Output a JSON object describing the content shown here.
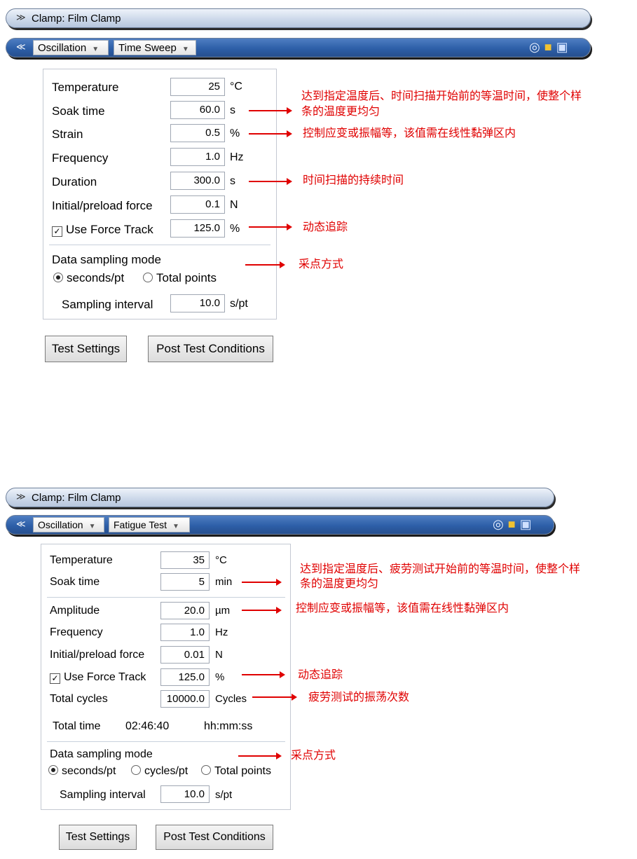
{
  "panel1": {
    "clamp_label": "Clamp: Film Clamp",
    "mode_select": "Oscillation",
    "test_select": "Time Sweep",
    "rows": [
      {
        "label": "Temperature",
        "value": "25",
        "unit": "°C"
      },
      {
        "label": "Soak time",
        "value": "60.0",
        "unit": "s"
      },
      {
        "label": "Strain",
        "value": "0.5",
        "unit": "%"
      },
      {
        "label": "Frequency",
        "value": "1.0",
        "unit": "Hz"
      },
      {
        "label": "Duration",
        "value": "300.0",
        "unit": "s"
      },
      {
        "label": "Initial/preload force",
        "value": "0.1",
        "unit": "N"
      },
      {
        "label": "Use Force Track",
        "value": "125.0",
        "unit": "%"
      }
    ],
    "sampling": {
      "title": "Data sampling mode",
      "opt1": "seconds/pt",
      "opt2": "Total points",
      "interval_label": "Sampling interval",
      "interval_value": "10.0",
      "interval_unit": "s/pt"
    },
    "buttons": {
      "test_settings": "Test Settings",
      "post_test": "Post Test Conditions"
    },
    "notes": {
      "soak_line1": "达到指定温度后、时间扫描开始前的等温时间，使整个样",
      "soak_line2": "条的温度更均匀",
      "strain": "控制应变或振幅等，该值需在线性黏弹区内",
      "duration": "时间扫描的持续时间",
      "force_track": "动态追踪",
      "sampling": "采点方式"
    }
  },
  "panel2": {
    "clamp_label": "Clamp: Film Clamp",
    "mode_select": "Oscillation",
    "test_select": "Fatigue Test",
    "rows": [
      {
        "label": "Temperature",
        "value": "35",
        "unit": "°C"
      },
      {
        "label": "Soak time",
        "value": "5",
        "unit": "min"
      },
      {
        "label": "Amplitude",
        "value": "20.0",
        "unit": "µm"
      },
      {
        "label": "Frequency",
        "value": "1.0",
        "unit": "Hz"
      },
      {
        "label": "Initial/preload force",
        "value": "0.01",
        "unit": "N"
      },
      {
        "label": "Use Force Track",
        "value": "125.0",
        "unit": "%"
      },
      {
        "label": "Total cycles",
        "value": "10000.0",
        "unit": "Cycles"
      }
    ],
    "total_time": {
      "label": "Total time",
      "value": "02:46:40",
      "unit": "hh:mm:ss"
    },
    "sampling": {
      "title": "Data sampling mode",
      "opt1": "seconds/pt",
      "opt2": "cycles/pt",
      "opt3": "Total points",
      "interval_label": "Sampling interval",
      "interval_value": "10.0",
      "interval_unit": "s/pt"
    },
    "buttons": {
      "test_settings": "Test Settings",
      "post_test": "Post Test Conditions"
    },
    "notes": {
      "soak_line1": "达到指定温度后、疲劳测试开始前的等温时间，使整个样",
      "soak_line2": "条的温度更均匀",
      "amplitude": "控制应变或振幅等，该值需在线性黏弹区内",
      "force_track": "动态追踪",
      "cycles": "疲劳测试的振荡次数",
      "sampling": "采点方式"
    }
  },
  "icons": {
    "collapse": "double-chevron",
    "globe": "globe-icon",
    "folder": "folder-icon",
    "save": "save-icon"
  }
}
